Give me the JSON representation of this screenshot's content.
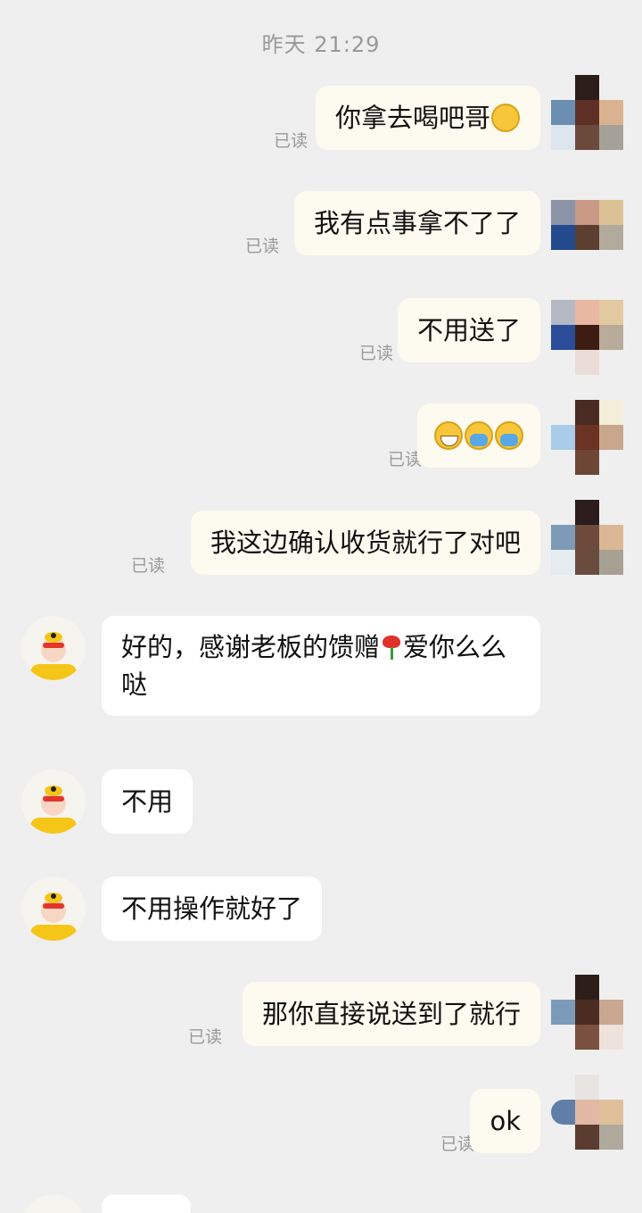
{
  "timestamp": "昨天 21:29",
  "read_label": "已读",
  "messages": [
    {
      "from": "me",
      "text": "你拿去喝吧哥"
    },
    {
      "from": "me",
      "text": "我有点事拿不了了"
    },
    {
      "from": "me",
      "text": "不用送了"
    },
    {
      "from": "me",
      "text": ""
    },
    {
      "from": "me",
      "text": "我这边确认收货就行了对吧"
    },
    {
      "from": "peer",
      "text_a": "好的，感谢老板的馈赠",
      "text_b": "爱你么么哒"
    },
    {
      "from": "peer",
      "text": "不用"
    },
    {
      "from": "peer",
      "text": "不用操作就好了"
    },
    {
      "from": "me",
      "text": "那你直接说送到了就行"
    },
    {
      "from": "me",
      "text": "ok"
    }
  ],
  "icons": [
    "flushed-emoji-icon",
    "grin-emoji-icon",
    "crying-emoji-icon",
    "rose-emoji-icon"
  ],
  "colors": {
    "background": "#efefef",
    "my_bubble": "#fdfaef",
    "peer_bubble": "#ffffff",
    "read_text": "#9a9a9a"
  }
}
